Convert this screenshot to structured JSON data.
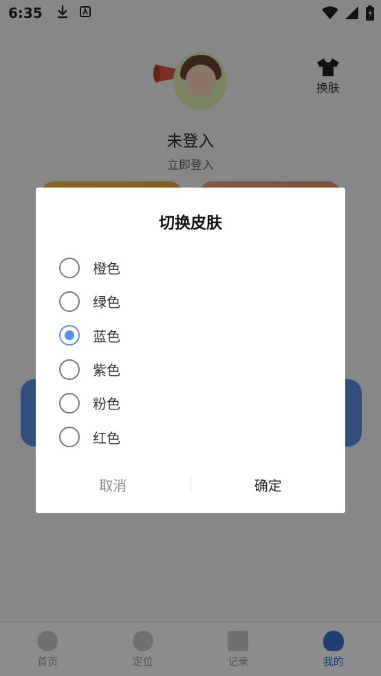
{
  "status_bar": {
    "time": "6:35"
  },
  "profile": {
    "username": "未登入",
    "login_link": "立即登入",
    "skin_button": "换肤"
  },
  "tabs": [
    {
      "label": "首页"
    },
    {
      "label": "定位"
    },
    {
      "label": "记录"
    },
    {
      "label": "我的"
    }
  ],
  "dialog": {
    "title": "切换皮肤",
    "options": [
      {
        "label": "橙色",
        "checked": false
      },
      {
        "label": "绿色",
        "checked": false
      },
      {
        "label": "蓝色",
        "checked": true
      },
      {
        "label": "紫色",
        "checked": false
      },
      {
        "label": "粉色",
        "checked": false
      },
      {
        "label": "红色",
        "checked": false
      }
    ],
    "cancel_label": "取消",
    "ok_label": "确定",
    "accent_color": "#5b8ef0"
  }
}
